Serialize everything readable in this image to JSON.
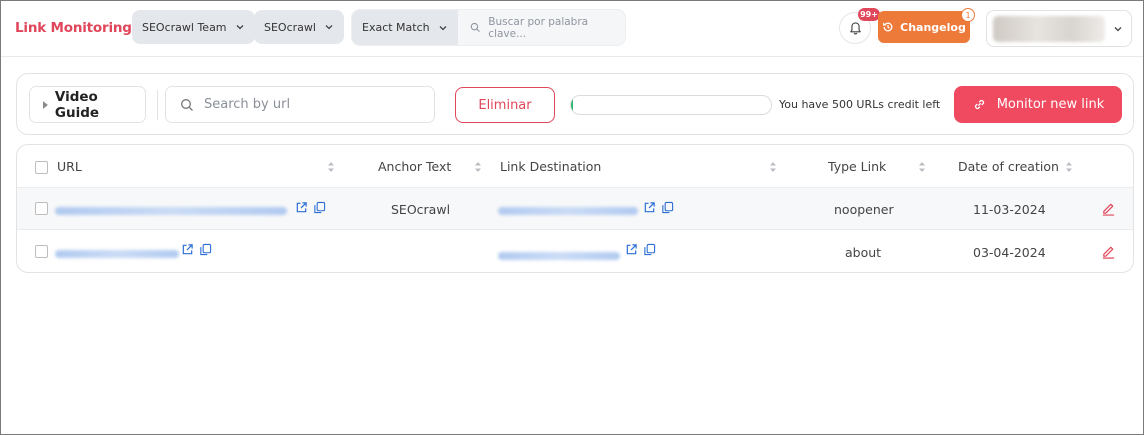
{
  "header": {
    "brand": "Link Monitoring",
    "team_select": "SEOcrawl Team",
    "project_select": "SEOcrawl",
    "match_select": "Exact Match",
    "keyword_placeholder": "Buscar por palabra clave...",
    "notifications_badge": "99+",
    "changelog_label": "Changelog",
    "changelog_badge": "1"
  },
  "toolbar": {
    "video_guide_label": "Video Guide",
    "search_placeholder": "Search by url",
    "delete_label": "Eliminar",
    "credit_text": "You have 500 URLs credit left",
    "credit_progress": 0.01,
    "monitor_label": "Monitor new link"
  },
  "table": {
    "columns": [
      "URL",
      "Anchor Text",
      "Link Destination",
      "Type Link",
      "Date of creation"
    ],
    "rows": [
      {
        "anchor_text": "SEOcrawl",
        "type_link": "noopener",
        "date": "11-03-2024"
      },
      {
        "anchor_text": "",
        "type_link": "about",
        "date": "03-04-2024"
      }
    ]
  },
  "colors": {
    "brand": "#e0475b",
    "accent": "#f04a60",
    "changelog": "#ee7a3a",
    "link": "#2d6fd6",
    "progress": "#2fb56a"
  },
  "icons": [
    "chevron-down-icon",
    "search-icon",
    "bell-icon",
    "history-icon",
    "play-triangle-icon",
    "link-icon",
    "sort-icon",
    "external-link-icon",
    "copy-icon",
    "edit-icon"
  ]
}
